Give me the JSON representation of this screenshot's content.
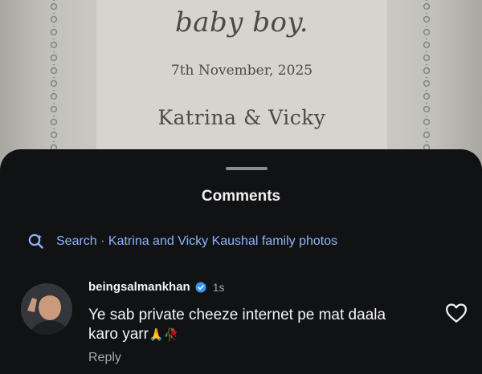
{
  "announcement": {
    "line1": "baby boy.",
    "line2": "7th November, 2025",
    "line3": "Katrina & Vicky"
  },
  "sheet": {
    "title": "Comments",
    "search": {
      "icon": "search-icon",
      "text": "Search · Katrina and Vicky Kaushal family photos"
    }
  },
  "comment": {
    "username": "beingsalmankhan",
    "verified": true,
    "time": "1s",
    "text": "Ye sab private cheeze internet pe mat daala karo yarr",
    "emojis": "🙏🥀",
    "reply_label": "Reply",
    "like_icon": "heart-outline-icon"
  },
  "colors": {
    "sheet_bg": "#111214",
    "search_accent": "#8fb4ff",
    "verified_badge": "#3897f0"
  }
}
